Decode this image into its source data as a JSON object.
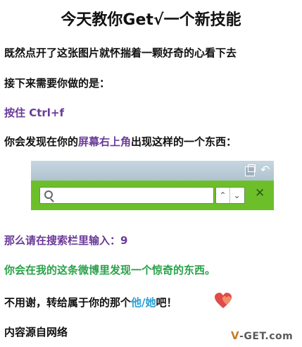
{
  "title": "今天教你Get√一个新技能",
  "lines": {
    "l1": "既然点开了这张图片就怀揣着一颗好奇的心看下去",
    "l2": "接下来需要你做的是：",
    "l3": "按住 Ctrl+f",
    "l4_pre": "你会发现在你的",
    "l4_hl": "屏幕右上角",
    "l4_post": "出现这样的一个东西：",
    "l5": "那么请在搜索栏里输入：9",
    "l6": "你会在我的这条微博里发现一个惊奇的东西。",
    "l7_pre": "不用谢，转给属于你的那个",
    "l7_hl": "他/她",
    "l7_post": "吧！",
    "l8": "内容源自网络"
  },
  "find_bar": {
    "search_value": "",
    "icons": [
      "new-tab-icon",
      "back-arrow-icon",
      "search-icon",
      "chevron-up-icon",
      "chevron-down-icon",
      "close-icon"
    ]
  },
  "watermark": {
    "prefix": "V",
    "rest": "-GET.com"
  },
  "colors": {
    "purple": "#6a3a98",
    "green": "#2aa24a",
    "blue": "#2a9fd6",
    "find_bar_green": "#6dbf2a"
  }
}
